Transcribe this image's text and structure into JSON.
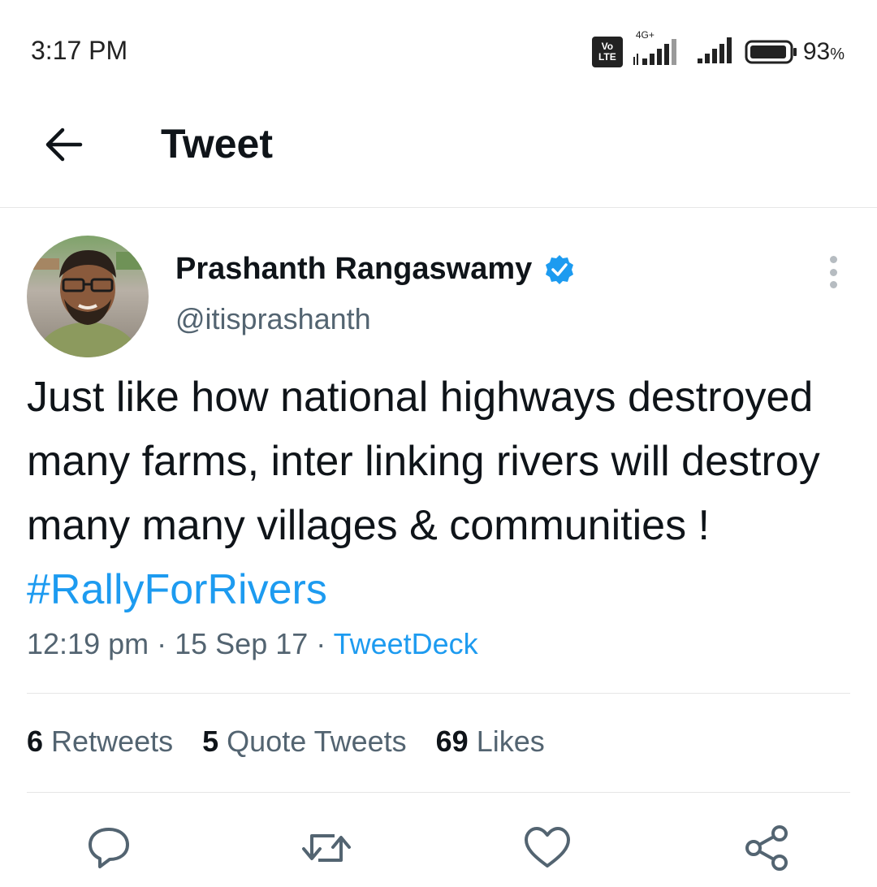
{
  "status_bar": {
    "time": "3:17 PM",
    "volte_line1": "Vo",
    "volte_line2": "LTE",
    "network": "4G+",
    "battery_percent": "93",
    "battery_unit": "%"
  },
  "header": {
    "title": "Tweet",
    "back_icon": "arrow-left-icon"
  },
  "tweet": {
    "author_name": "Prashanth Rangaswamy",
    "handle": "@itisprashanth",
    "verified": true,
    "text": "Just like how national highways destroyed many farms, inter linking rivers will destroy many many villages & communities ! ",
    "hashtag": "#RallyForRivers",
    "time": "12:19 pm",
    "date": "15 Sep 17",
    "separator": " · ",
    "source": "TweetDeck"
  },
  "stats": {
    "retweets_count": "6",
    "retweets_label": "Retweets",
    "quotes_count": "5",
    "quotes_label": "Quote Tweets",
    "likes_count": "69",
    "likes_label": "Likes"
  },
  "actions": {
    "icons": [
      "reply-icon",
      "retweet-icon",
      "like-icon",
      "share-icon"
    ]
  },
  "colors": {
    "accent": "#1d9bf0",
    "text_primary": "#0f1419",
    "text_secondary": "#536471",
    "divider": "#e6e6e6"
  }
}
